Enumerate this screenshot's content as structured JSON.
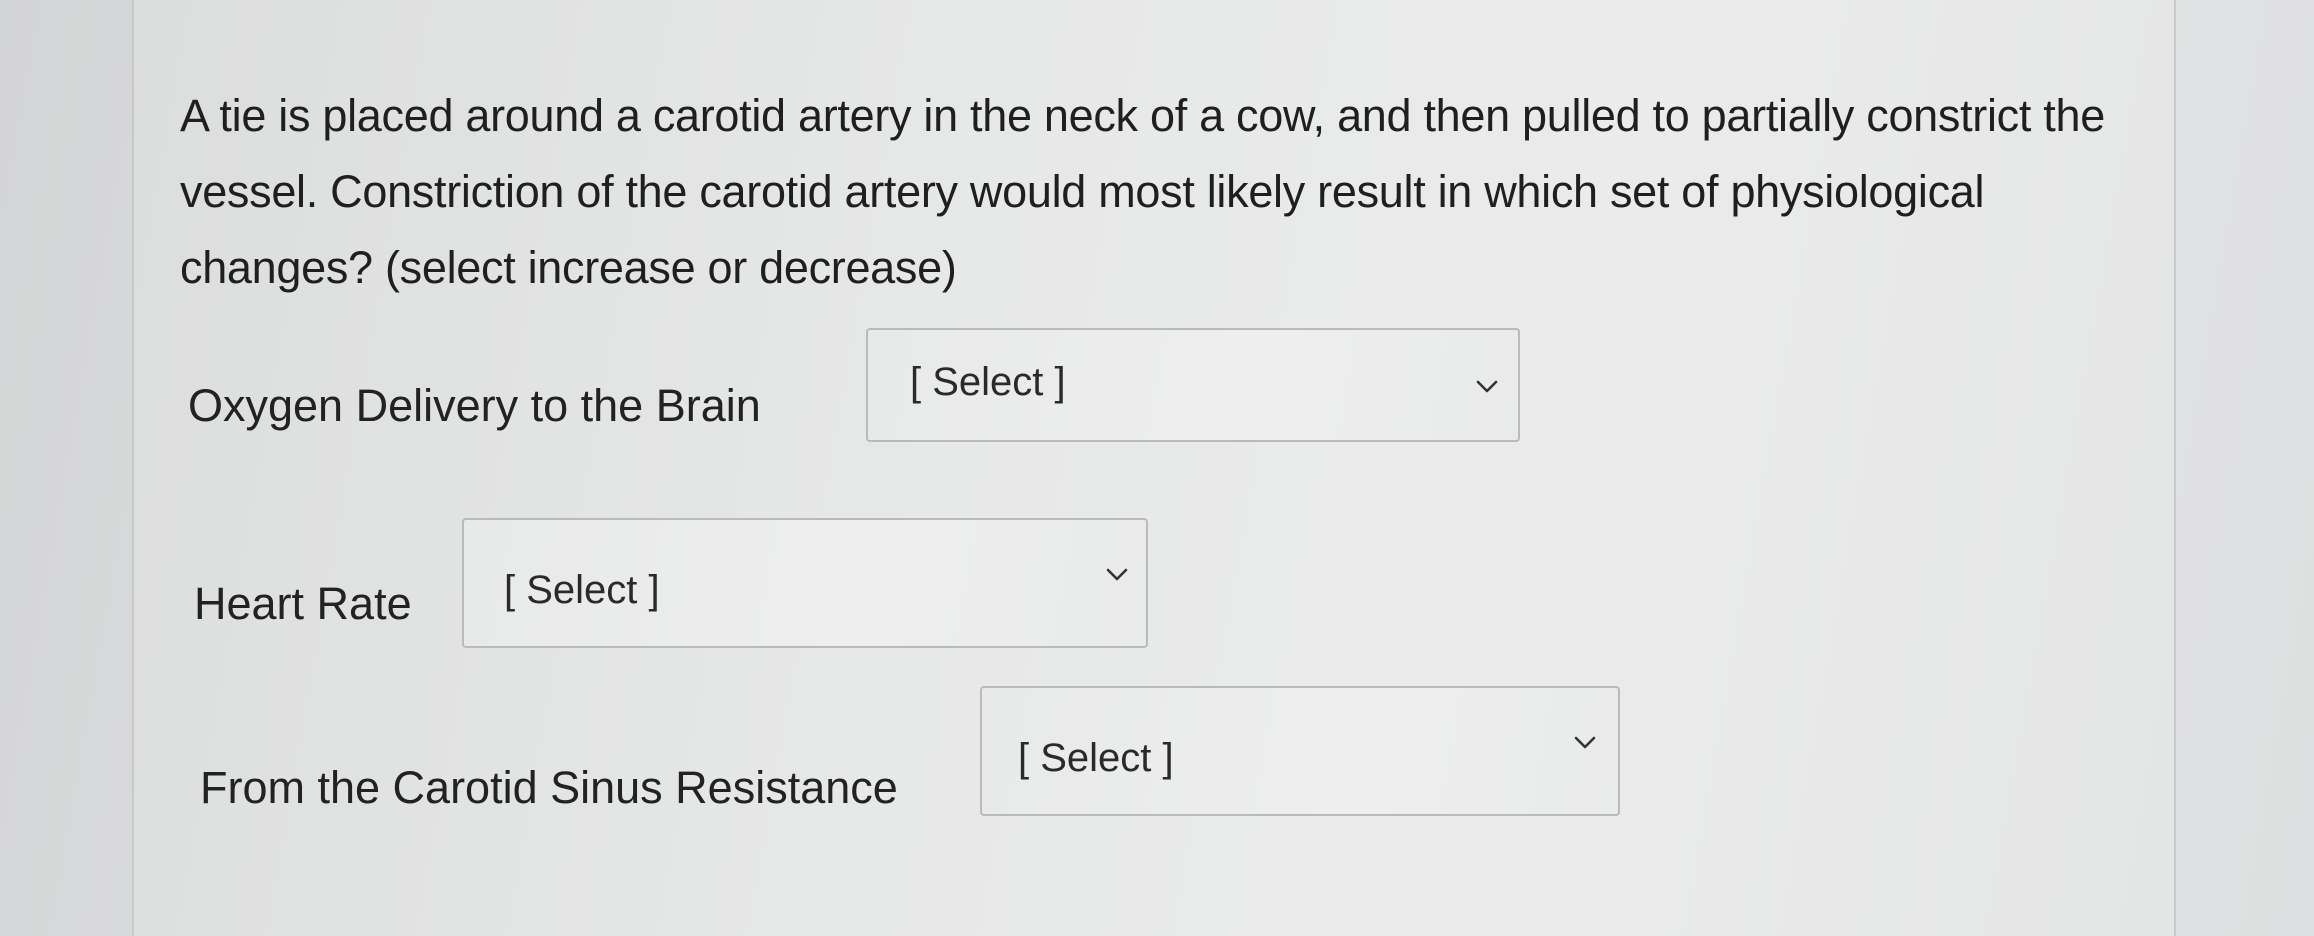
{
  "question": {
    "text": "A tie is placed around a carotid artery in the neck of a cow, and then pulled to partially constrict the vessel. Constriction of the carotid artery would most likely result in which set of physiological changes? (select increase or decrease)"
  },
  "rows": [
    {
      "label": "Oxygen Delivery to the Brain",
      "selected": "[ Select ]"
    },
    {
      "label": "Heart Rate",
      "selected": "[ Select ]"
    },
    {
      "label": "From the Carotid Sinus Resistance",
      "selected": "[ Select ]"
    }
  ],
  "icons": {
    "dropdown": "chevron-down-icon"
  }
}
